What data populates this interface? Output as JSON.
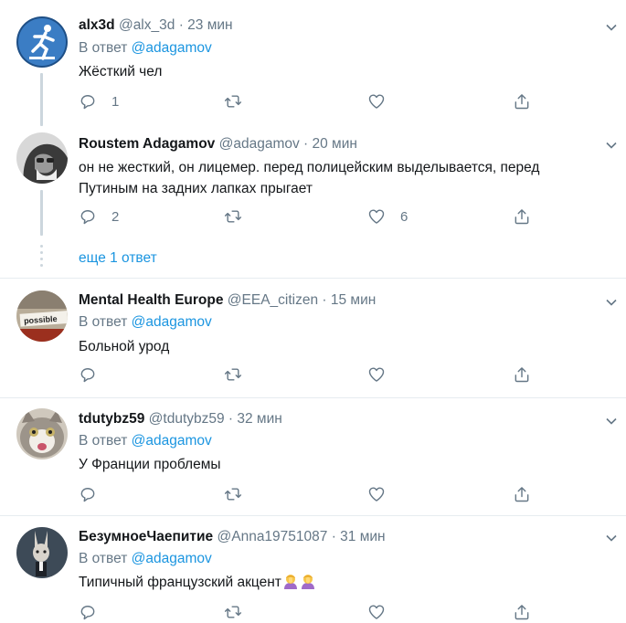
{
  "tweets": [
    {
      "name": "alx3d",
      "handle": "@alx_3d",
      "time": "· 23 мин",
      "reply_prefix": "В ответ",
      "reply_mention": "@adagamov",
      "text": "Жёсткий чел",
      "replies": "1",
      "retweets": "",
      "likes": ""
    },
    {
      "name": "Roustem Adagamov",
      "handle": "@adagamov",
      "time": "· 20 мин",
      "text_line1": "он не жесткий, он лицемер. перед полицейским выделывается, перед",
      "text_line2": "Путиным на задних лапках прыгает",
      "replies": "2",
      "retweets": "",
      "likes": "6"
    },
    {
      "name": "Mental Health Europe",
      "handle": "@EEA_citizen",
      "time": "· 15 мин",
      "reply_prefix": "В ответ",
      "reply_mention": "@adagamov",
      "text": "Больной урод",
      "avatar_text": "possible"
    },
    {
      "name": "tdutybz59",
      "handle": "@tdutybz59",
      "time": "· 32 мин",
      "reply_prefix": "В ответ",
      "reply_mention": "@adagamov",
      "text": "У Франции проблемы"
    },
    {
      "name": "БезумноеЧаепитие",
      "handle": "@Anna19751087",
      "time": "· 31 мин",
      "reply_prefix": "В ответ",
      "reply_mention": "@adagamov",
      "text": "Типичный французский акцент",
      "emoji": [
        "woman-facepalming-emoji",
        "woman-facepalming-emoji"
      ]
    }
  ],
  "show_more": "еще 1 ответ",
  "colors": {
    "accent": "#1b95e0",
    "muted": "#657786",
    "divider": "#e6ecf0",
    "thread": "#ccd6dd"
  },
  "icons": [
    "reply-icon",
    "retweet-icon",
    "like-icon",
    "share-icon",
    "chevron-down-icon"
  ]
}
